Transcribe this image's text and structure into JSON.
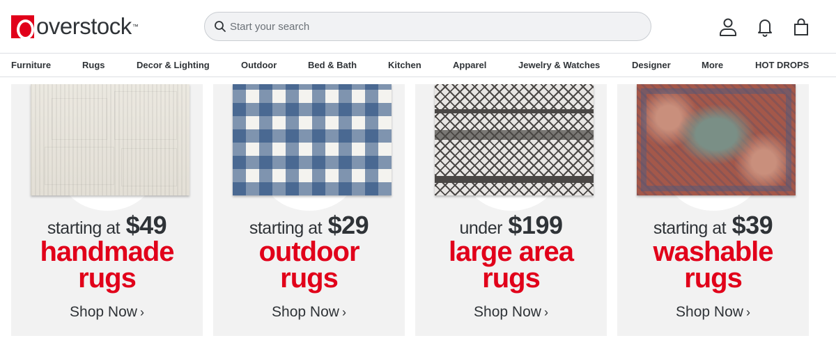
{
  "header": {
    "logo_text": "overstock",
    "logo_tm": "™",
    "search_placeholder": "Start your search",
    "icons": [
      "account-icon",
      "bell-icon",
      "cart-bag-icon"
    ]
  },
  "nav": {
    "items": [
      "Furniture",
      "Rugs",
      "Decor & Lighting",
      "Outdoor",
      "Bed & Bath",
      "Kitchen",
      "Apparel",
      "Jewelry & Watches",
      "Designer",
      "More",
      "HOT DROPS"
    ]
  },
  "cards": [
    {
      "price_prefix": "starting at",
      "price": "$49",
      "line1": "handmade",
      "line2": "rugs",
      "cta": "Shop Now",
      "chevron": "›"
    },
    {
      "price_prefix": "starting at",
      "price": "$29",
      "line1": "outdoor",
      "line2": "rugs",
      "cta": "Shop Now",
      "chevron": "›"
    },
    {
      "price_prefix": "under",
      "price": "$199",
      "line1": "large area",
      "line2": "rugs",
      "cta": "Shop Now",
      "chevron": "›"
    },
    {
      "price_prefix": "starting at",
      "price": "$39",
      "line1": "washable",
      "line2": "rugs",
      "cta": "Shop Now",
      "chevron": "›"
    }
  ],
  "colors": {
    "brand_red": "#e1001a",
    "text_dark": "#2f3337",
    "card_bg": "#f2f2f2"
  }
}
